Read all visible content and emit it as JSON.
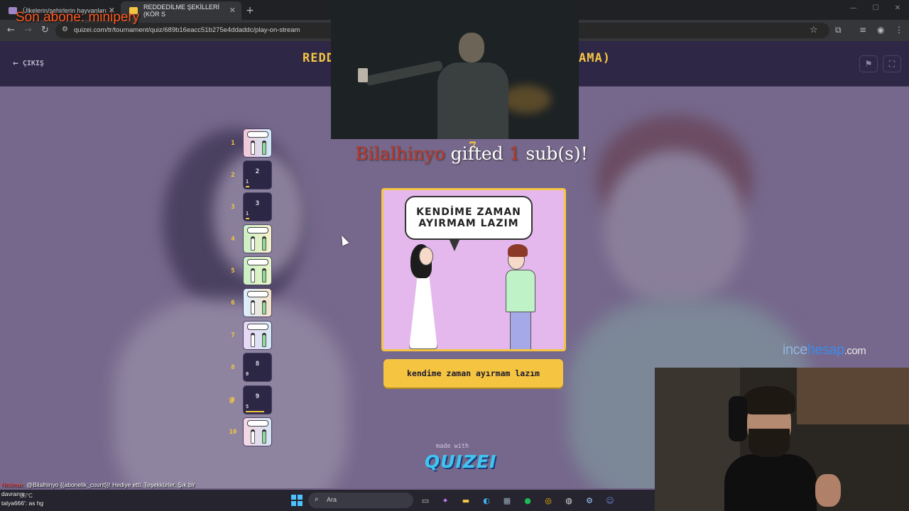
{
  "browser": {
    "tabs": [
      {
        "label": "Ülkelerin/şehirlerin hayvanları",
        "active": false
      },
      {
        "label": "REDDEDİLME ŞEKİLLERİ (KÖR S",
        "active": true
      }
    ],
    "url": "quizei.com/tr/tournament/quiz/689b16eacc51b275e4ddaddc/play-on-stream"
  },
  "overlay": {
    "son_abone": "Son abone: minipery",
    "gift": {
      "name": "Bilalhinyo",
      "middle": " gifted ",
      "count": "1",
      "suffix": " sub(s)!",
      "top_number": "7"
    }
  },
  "quiz": {
    "exit_label": "ÇIKIŞ",
    "title_left": "REDD",
    "title_right": "AMA)",
    "rounds": [
      {
        "number": "1",
        "type": "image",
        "colors": [
          "#f4c7d8",
          "#cfe8f7"
        ]
      },
      {
        "number": "2",
        "type": "pending",
        "inner": "2",
        "score": "1",
        "fill": 0.15
      },
      {
        "number": "3",
        "type": "pending",
        "inner": "3",
        "score": "1",
        "fill": 0.15
      },
      {
        "number": "4",
        "type": "image",
        "colors": [
          "#c9f0c4",
          "#f5f0c9"
        ]
      },
      {
        "number": "5",
        "type": "image",
        "colors": [
          "#c9f0c4",
          "#e8f5c9"
        ]
      },
      {
        "number": "6",
        "type": "image",
        "colors": [
          "#dceeff",
          "#f6e4c8"
        ]
      },
      {
        "number": "7",
        "type": "image",
        "colors": [
          "#e9d6f5",
          "#d6e9f5"
        ]
      },
      {
        "number": "8",
        "type": "pending",
        "inner": "8",
        "score": "0",
        "fill": 0
      },
      {
        "number": "9",
        "type": "pending",
        "inner": "9",
        "score": "5",
        "fill": 0.75
      },
      {
        "number": "10",
        "type": "image",
        "colors": [
          "#f5d6e4",
          "#d6e4f5"
        ]
      }
    ],
    "question": {
      "bubble_line1": "KENDİME ZAMAN",
      "bubble_line2": "AYIRMAM LAZIM"
    },
    "answer_label": "kendime zaman ayırmam lazım",
    "made_with": "made with",
    "logo_text": "QUIZEI"
  },
  "sponsor": {
    "part1": "ince",
    "part2": "hesap",
    "part3": ".com"
  },
  "chat": {
    "line1_user": "Nıcknax",
    "line1_text": ": @Bilalhinyo {{abonelik_count}}! Hediye etti. Teşekkürler. Şık bir",
    "line2": "davranış",
    "line3_user": "talya666",
    "line3_text": "': as hg"
  },
  "taskbar": {
    "weather": "25°C",
    "search_placeholder": "Ara"
  }
}
